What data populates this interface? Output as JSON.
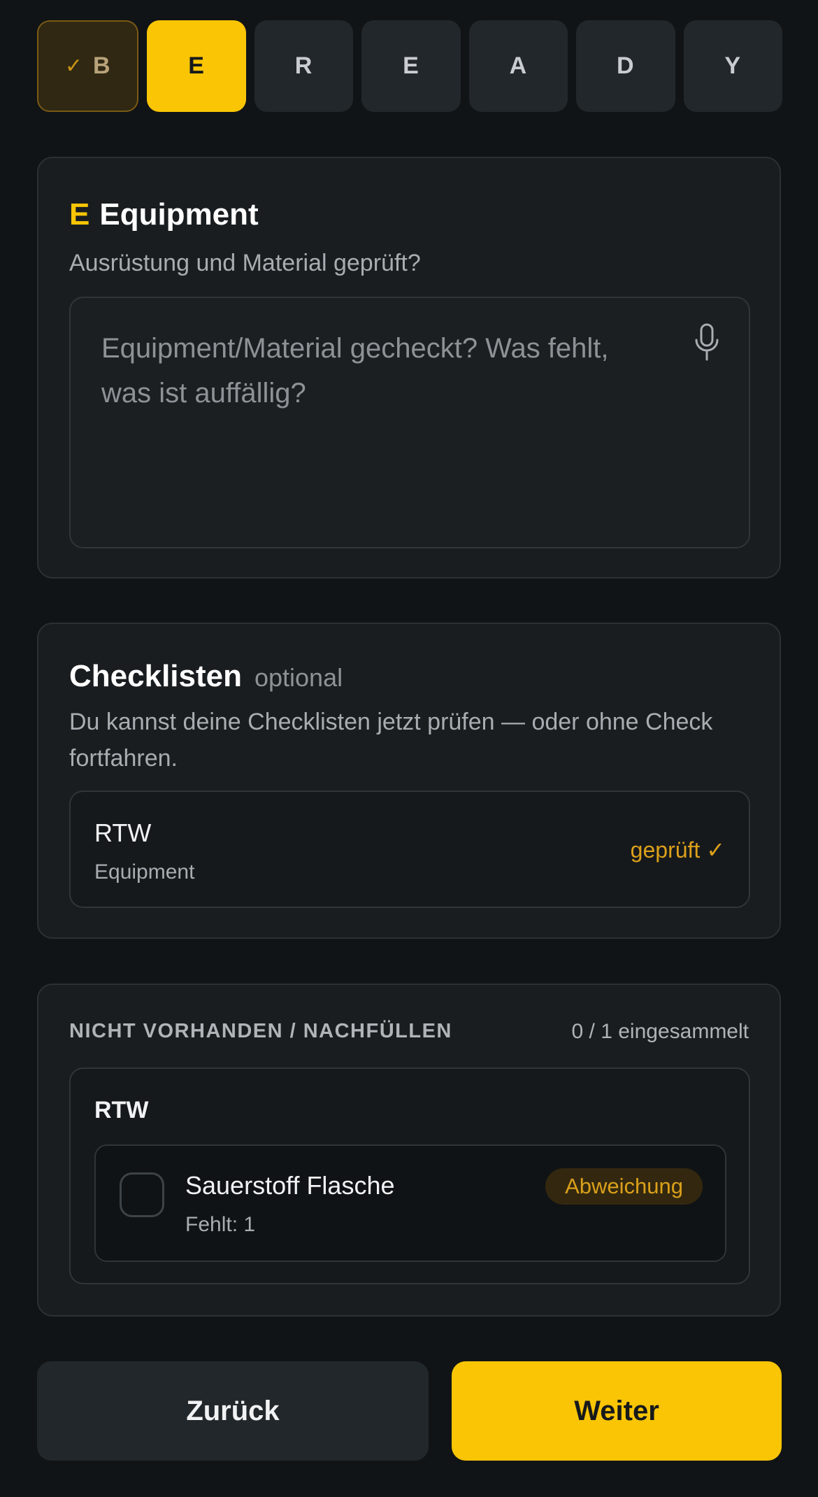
{
  "steps": [
    {
      "letter": "B",
      "state": "done"
    },
    {
      "letter": "E",
      "state": "active"
    },
    {
      "letter": "R",
      "state": "pending"
    },
    {
      "letter": "E",
      "state": "pending"
    },
    {
      "letter": "A",
      "state": "pending"
    },
    {
      "letter": "D",
      "state": "pending"
    },
    {
      "letter": "Y",
      "state": "pending"
    }
  ],
  "done_check": "✓",
  "equipment": {
    "letter": "E",
    "title": "Equipment",
    "subtitle": "Ausrüstung und Material geprüft?",
    "placeholder": "Equipment/Material gecheckt? Was fehlt, was ist auffällig?",
    "mic_icon": "microphone-icon"
  },
  "checklists": {
    "title": "Checklisten",
    "optional_label": "optional",
    "description": "Du kannst deine Checklisten jetzt prüfen — oder ohne Check fortfahren.",
    "items": [
      {
        "name": "RTW",
        "category": "Equipment",
        "status": "geprüft ✓"
      }
    ]
  },
  "missing": {
    "header": "NICHT VORHANDEN / NACHFÜLLEN",
    "count": "0 / 1 eingesammelt",
    "groups": [
      {
        "name": "RTW",
        "items": [
          {
            "name": "Sauerstoff Flasche",
            "missing": "Fehlt: 1",
            "badge": "Abweichung",
            "checked": false
          }
        ]
      }
    ]
  },
  "buttons": {
    "back": "Zurück",
    "next": "Weiter"
  },
  "colors": {
    "accent": "#f9c505",
    "warning": "#dba01a",
    "background": "#111416",
    "card": "#191d20"
  }
}
